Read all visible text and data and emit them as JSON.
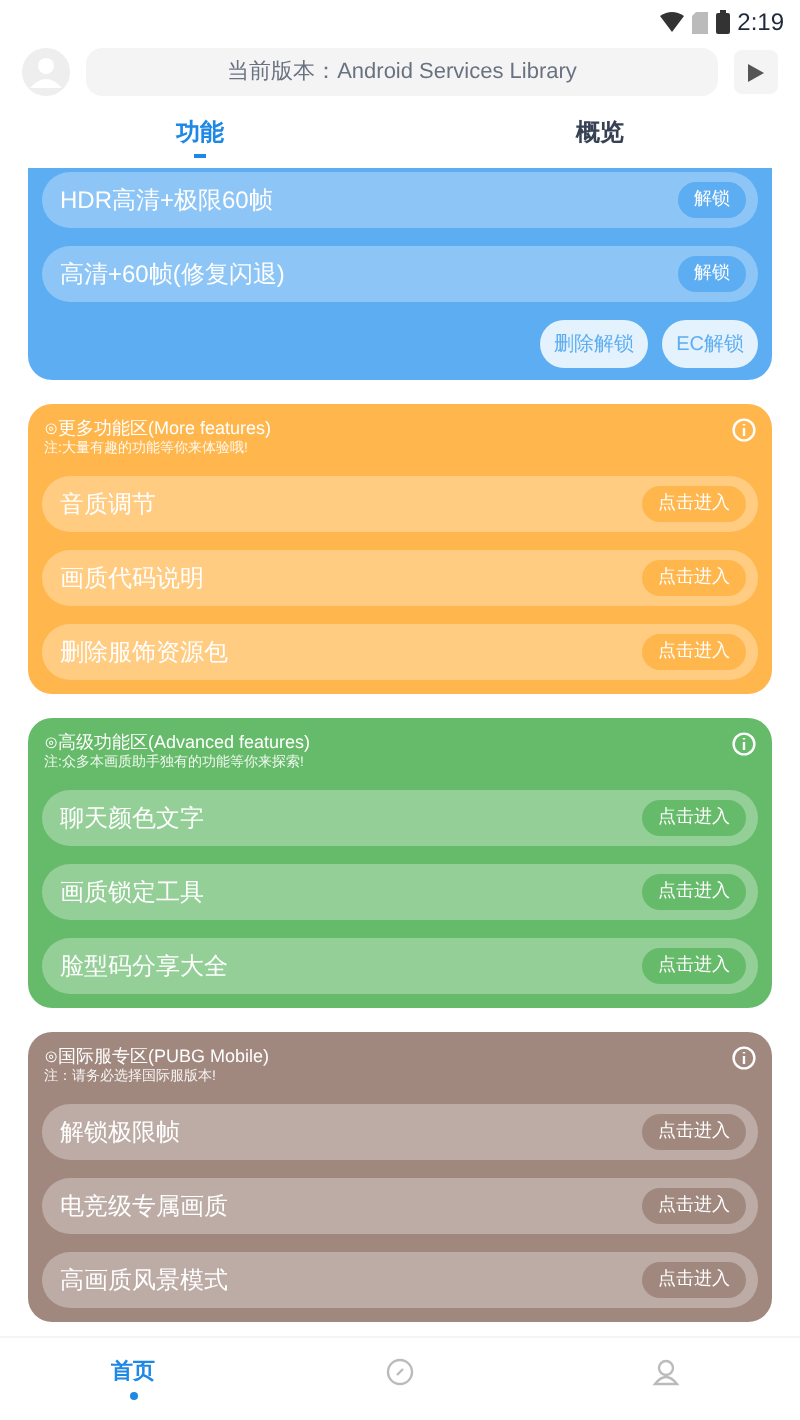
{
  "status_bar": {
    "time": "2:19"
  },
  "header": {
    "version": "当前版本：Android Services Library"
  },
  "tabs": [
    {
      "label": "功能",
      "selected": true
    },
    {
      "label": "概览",
      "selected": false
    }
  ],
  "unlock_panel": {
    "color": "#5cadf2",
    "rows": [
      {
        "label": "HDR高清+极限60帧",
        "button": "解锁"
      },
      {
        "label": "高清+60帧(修复闪退)",
        "button": "解锁"
      }
    ],
    "actions": [
      "删除解锁",
      "EC解锁"
    ]
  },
  "sections": [
    {
      "title": "⊙更多功能区(More features)",
      "note": "注:大量有趣的功能等你来体验哦!",
      "color": "#ffb74d",
      "rows": [
        {
          "label": "音质调节",
          "button": "点击进入"
        },
        {
          "label": "画质代码说明",
          "button": "点击进入"
        },
        {
          "label": "删除服饰资源包",
          "button": "点击进入"
        }
      ]
    },
    {
      "title": "⊙高级功能区(Advanced features)",
      "note": "注:众多本画质助手独有的功能等你来探索!",
      "color": "#66bb6a",
      "rows": [
        {
          "label": "聊天颜色文字",
          "button": "点击进入"
        },
        {
          "label": "画质锁定工具",
          "button": "点击进入"
        },
        {
          "label": "脸型码分享大全",
          "button": "点击进入"
        }
      ]
    },
    {
      "title": "⊙国际服专区(PUBG Mobile)",
      "note": "注：请务必选择国际服版本!",
      "color": "#a1887f",
      "rows": [
        {
          "label": "解锁极限帧",
          "button": "点击进入"
        },
        {
          "label": "电竞级专属画质",
          "button": "点击进入"
        },
        {
          "label": "高画质风景模式",
          "button": "点击进入"
        }
      ]
    }
  ],
  "bottom_nav": [
    {
      "kind": "home",
      "label": "首页",
      "selected": true
    },
    {
      "kind": "discover",
      "selected": false
    },
    {
      "kind": "profile",
      "selected": false
    }
  ]
}
